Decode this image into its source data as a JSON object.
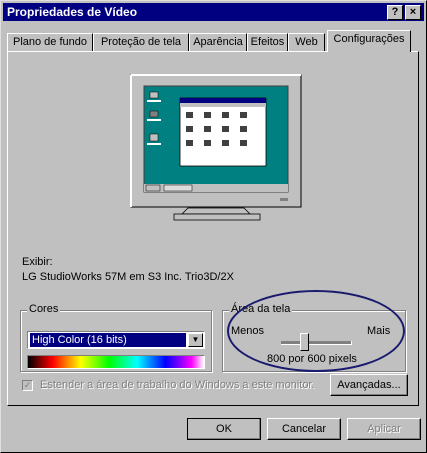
{
  "window": {
    "title": "Propriedades de Vídeo",
    "help_btn": "?",
    "close_btn": "×"
  },
  "tabs": [
    {
      "label": "Plano de fundo"
    },
    {
      "label": "Proteção de tela"
    },
    {
      "label": "Aparência"
    },
    {
      "label": "Efeitos"
    },
    {
      "label": "Web"
    },
    {
      "label": "Configurações",
      "active": true
    }
  ],
  "monitor_preview": {
    "desktop_color": "#008080",
    "desktop_icons": [
      "Meu computador",
      "Rede dialup",
      "Lixeira"
    ],
    "window_icons": 12
  },
  "display": {
    "label": "Exibir:",
    "device": "LG StudioWorks 57M em S3 Inc. Trio3D/2X"
  },
  "colors_group": {
    "legend": "Cores",
    "selected": "High Color (16 bits)"
  },
  "screen_area_group": {
    "legend": "Área da tela",
    "less": "Menos",
    "more": "Mais",
    "resolution": "800 por 600 pixels",
    "slider_fraction": 0.33
  },
  "extend_desktop": {
    "label": "Estender a área de trabalho do Windows a este monitor.",
    "checked": true,
    "enabled": false
  },
  "buttons": {
    "advanced": "Avançadas...",
    "ok": "OK",
    "cancel": "Cancelar",
    "apply": "Aplicar"
  },
  "accent_colors": {
    "title_bar": "#000080",
    "annotation_ellipse": "#1a1a6e"
  }
}
